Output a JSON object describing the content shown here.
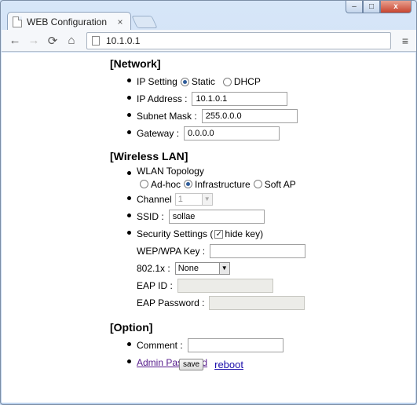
{
  "browser": {
    "tab_title": "WEB Configuration",
    "tab_close": "×",
    "url": "10.1.0.1",
    "back": "←",
    "forward": "→",
    "reload": "⟳",
    "home": "⌂",
    "menu": "≡",
    "window": {
      "minimize": "–",
      "maximize": "□",
      "close": "x"
    }
  },
  "network": {
    "heading": "[Network]",
    "ip_setting_label": "IP Setting",
    "ip_setting_options": [
      "Static",
      "DHCP"
    ],
    "ip_setting_selected": "Static",
    "ip_address_label": "IP Address :",
    "ip_address_value": "10.1.0.1",
    "subnet_mask_label": "Subnet Mask :",
    "subnet_mask_value": "255.0.0.0",
    "gateway_label": "Gateway :",
    "gateway_value": "0.0.0.0"
  },
  "wireless": {
    "heading": "[Wireless LAN]",
    "topology_label": "WLAN Topology",
    "topology_options": [
      "Ad-hoc",
      "Infrastructure",
      "Soft AP"
    ],
    "topology_selected": "Infrastructure",
    "channel_label": "Channel",
    "channel_value": "1",
    "ssid_label": "SSID :",
    "ssid_value": "sollae",
    "security_label_prefix": "Security Settings (",
    "hide_key_label": "hide key)",
    "hide_key_checked": true,
    "wep_label": "WEP/WPA Key :",
    "wep_value": "",
    "dot1x_label": "802.1x :",
    "dot1x_value": "None",
    "eap_id_label": "EAP ID :",
    "eap_id_value": "",
    "eap_password_label": "EAP Password :",
    "eap_password_value": ""
  },
  "option": {
    "heading": "[Option]",
    "comment_label": "Comment :",
    "comment_value": "",
    "admin_password_link": "Admin Password"
  },
  "actions": {
    "save_label": "save",
    "reboot_label": "reboot"
  }
}
